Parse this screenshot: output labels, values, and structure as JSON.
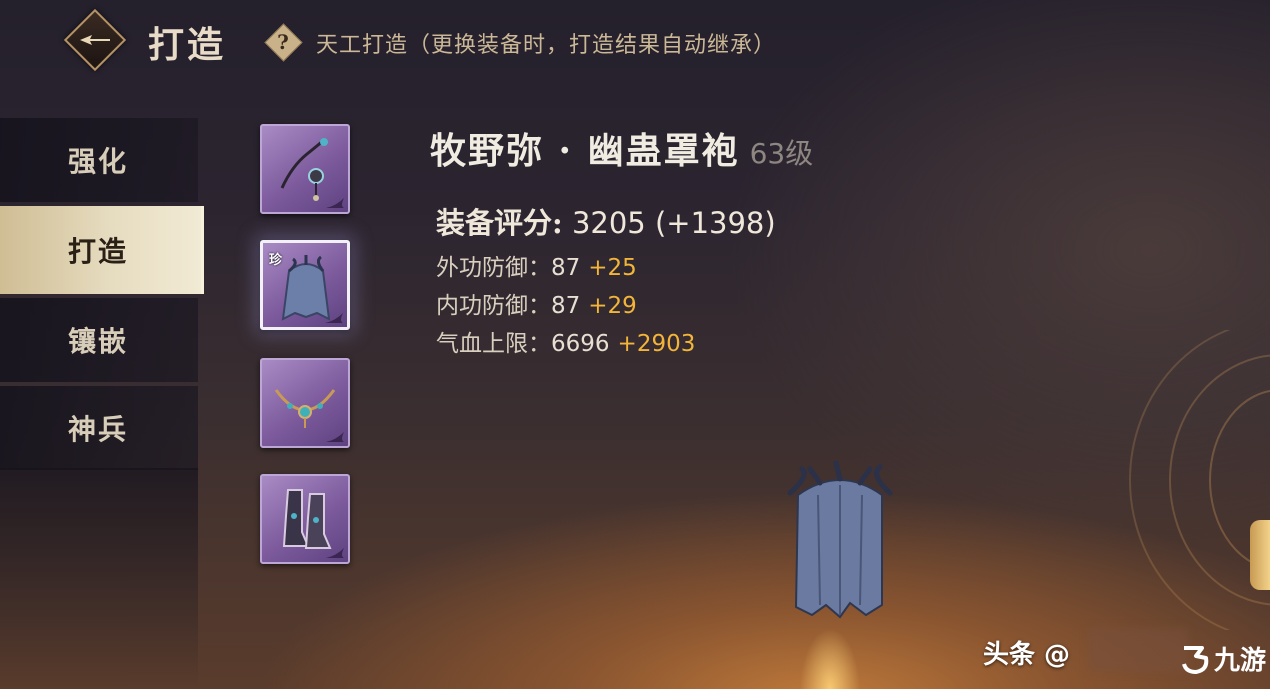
{
  "header": {
    "title": "打造",
    "help_icon_text": "?",
    "subtitle": "天工打造（更换装备时，打造结果自动继承）"
  },
  "tabs": [
    {
      "label": "强化",
      "active": false
    },
    {
      "label": "打造",
      "active": true
    },
    {
      "label": "镶嵌",
      "active": false
    },
    {
      "label": "神兵",
      "active": false
    }
  ],
  "slots": [
    {
      "name": "weapon",
      "selected": false,
      "badge": ""
    },
    {
      "name": "cloak",
      "selected": true,
      "badge": "珍"
    },
    {
      "name": "necklace",
      "selected": false,
      "badge": ""
    },
    {
      "name": "boots",
      "selected": false,
      "badge": ""
    }
  ],
  "item": {
    "name": "牧野弥 · 幽蛊罩袍",
    "level": "63级",
    "score_label": "装备评分:",
    "score_value": "3205 (+1398)",
    "stats": [
      {
        "label": "外功防御：",
        "value": "87",
        "bonus": "+25"
      },
      {
        "label": "内功防御：",
        "value": "87",
        "bonus": "+29"
      },
      {
        "label": "气血上限：",
        "value": "6696",
        "bonus": "+2903"
      }
    ]
  },
  "colors": {
    "bonus": "#f2b53a",
    "slot_purple": "#7d5b9d",
    "active_tab": "#e6dcc0"
  },
  "watermark": {
    "text": "头条 @",
    "site": "九游"
  }
}
